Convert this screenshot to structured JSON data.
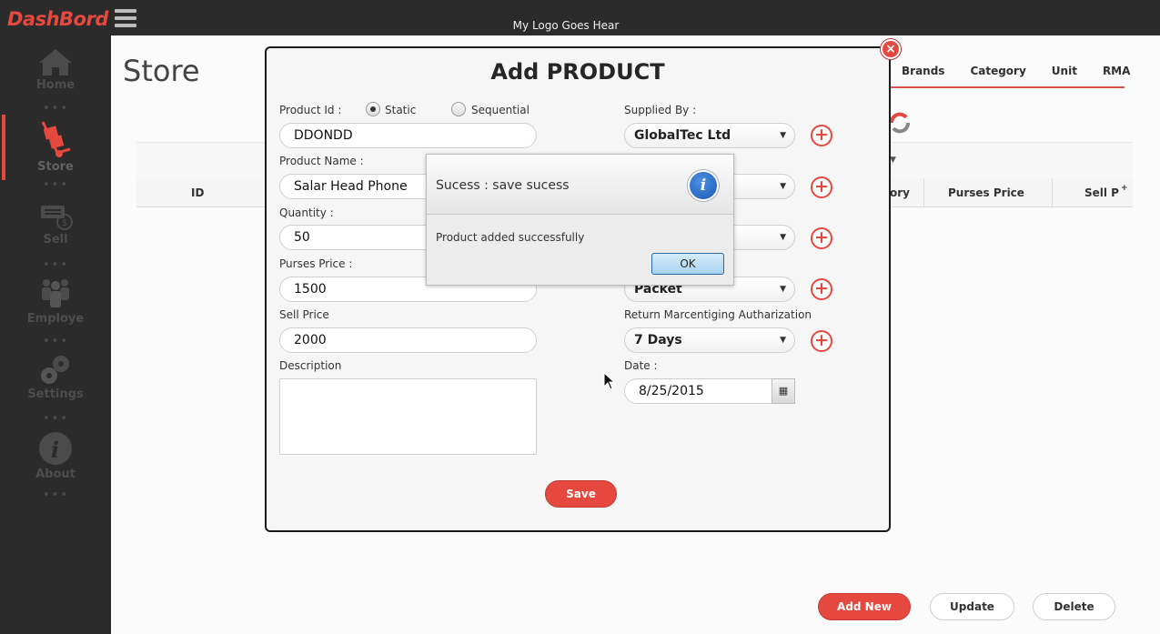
{
  "app": {
    "brand": "DashBord",
    "logo_text": "My Logo Goes Hear"
  },
  "sidebar": {
    "items": [
      {
        "label": "Home",
        "icon": "home-icon"
      },
      {
        "label": "Store",
        "icon": "hand-truck-icon",
        "active": true
      },
      {
        "label": "Sell",
        "icon": "cash-register-icon"
      },
      {
        "label": "Employe",
        "icon": "people-icon"
      },
      {
        "label": "Settings",
        "icon": "gears-icon"
      },
      {
        "label": "About",
        "icon": "info-icon"
      }
    ]
  },
  "store": {
    "title": "Store",
    "tabs": [
      "Brands",
      "Category",
      "Unit",
      "RMA"
    ],
    "table_headers": [
      "ID",
      "ory",
      "Purses Price",
      "Sell P"
    ],
    "buttons": {
      "add_new": "Add New",
      "update": "Update",
      "delete": "Delete"
    }
  },
  "dialog": {
    "title": "Add PRODUCT",
    "product_id_label": "Product Id :",
    "radio_static": "Static",
    "radio_sequential": "Sequential",
    "product_id_value": "DDONDD",
    "product_name_label": "Product Name :",
    "product_name_value": "Salar Head Phone",
    "quantity_label": "Quantity :",
    "quantity_value": "50",
    "purses_price_label": "Purses Price :",
    "purses_price_value": "1500",
    "sell_price_label": "Sell Price",
    "sell_price_value": "2000",
    "description_label": "Description",
    "supplied_by_label": "Supplied By :",
    "supplied_by_value": "GlobalTec Ltd",
    "unit_value": "Packet",
    "rma_label": "Return Marcentiging Autharization",
    "rma_value": "7 Days",
    "date_label": "Date :",
    "date_value": "8/25/2015",
    "save_label": "Save"
  },
  "alert": {
    "title": "Sucess : save sucess",
    "message": "Product added successfully",
    "ok_label": "OK"
  },
  "colors": {
    "accent": "#e5483e",
    "sidebar_bg": "#2b2b2b"
  }
}
